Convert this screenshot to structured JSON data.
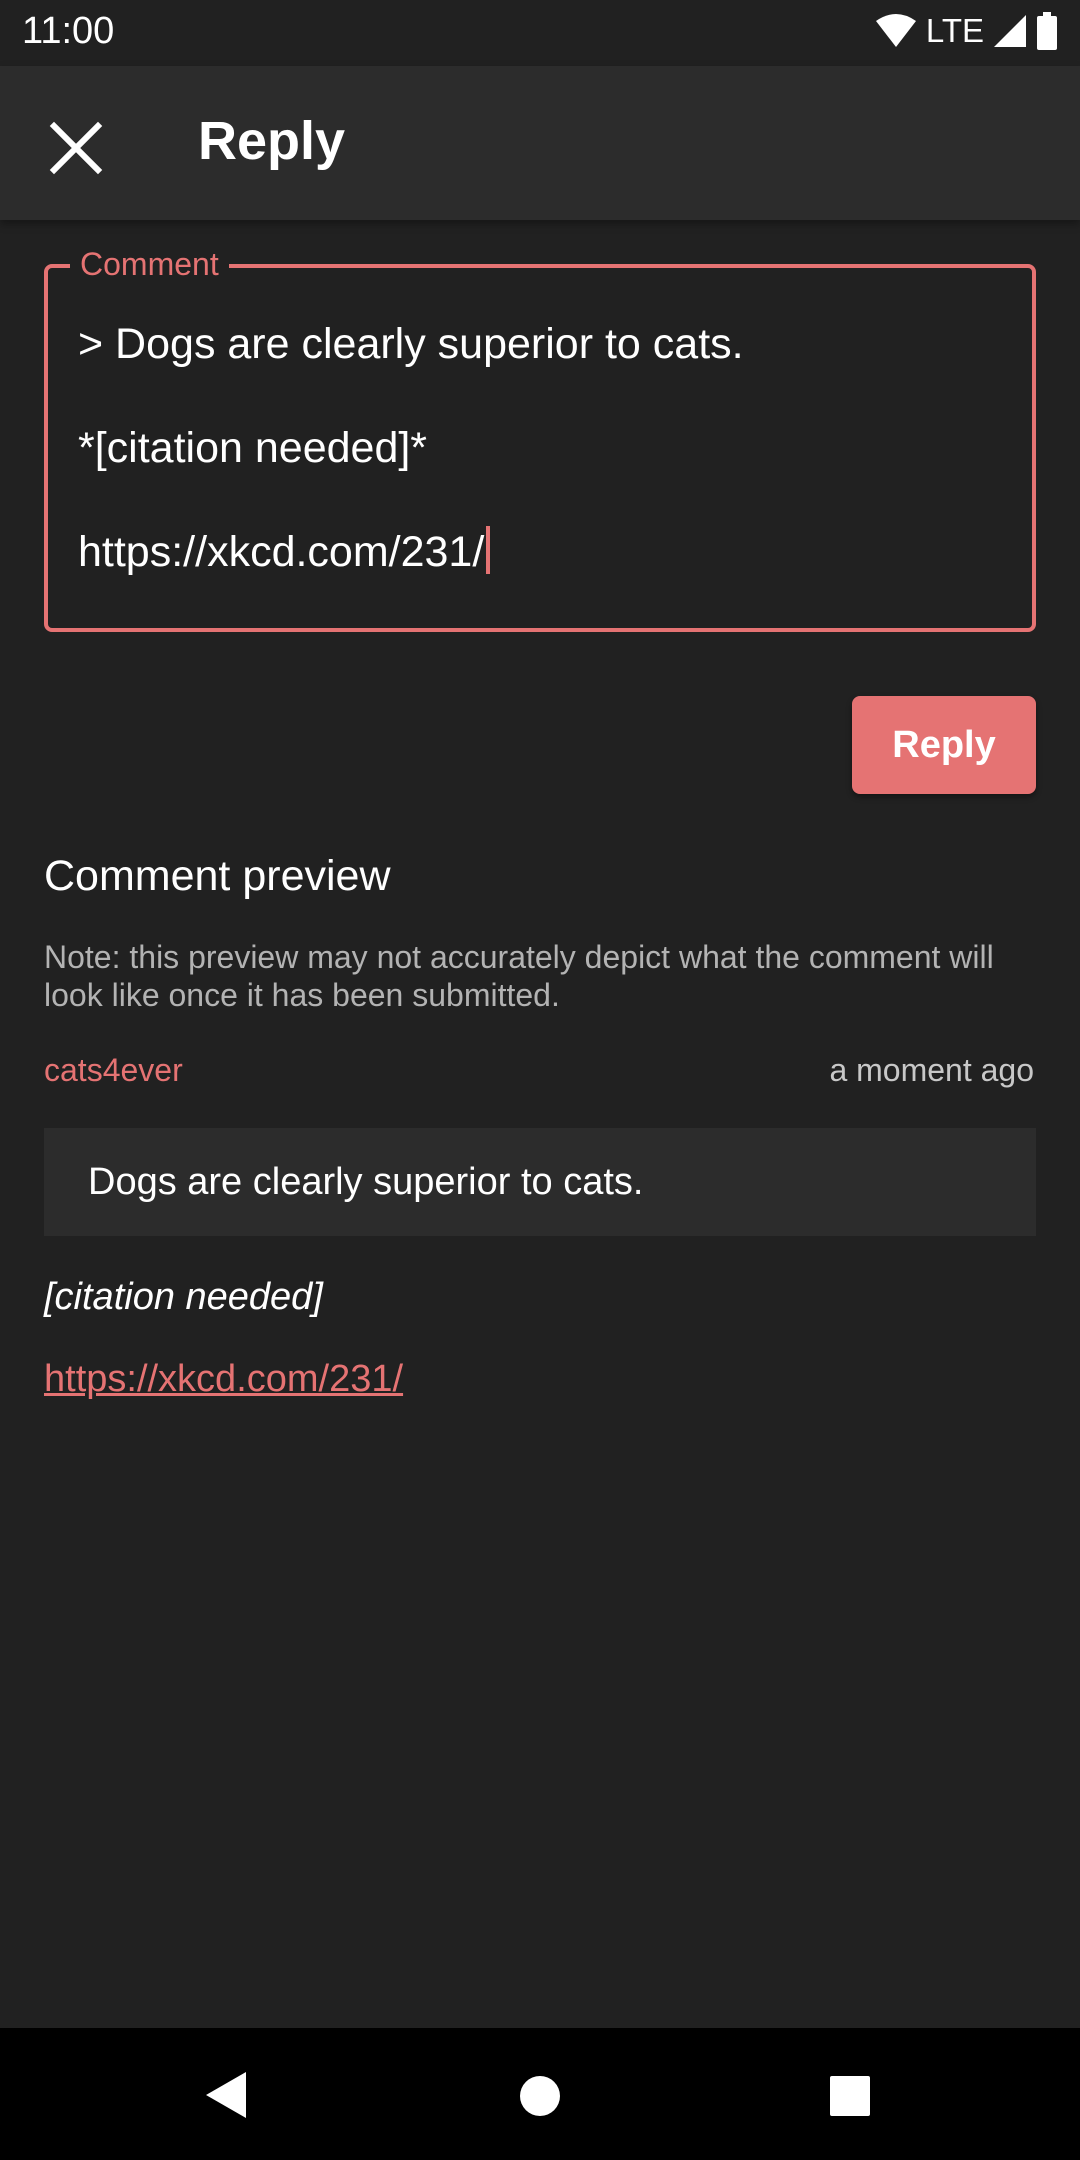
{
  "status_bar": {
    "time": "11:00",
    "network": "LTE",
    "icons": [
      "wifi-icon",
      "signal-icon",
      "battery-icon"
    ]
  },
  "app_bar": {
    "title": "Reply",
    "close_icon": "close-icon"
  },
  "comment_field": {
    "label": "Comment",
    "lines": [
      "> Dogs are clearly superior to cats.",
      "*[citation needed]*",
      "https://xkcd.com/231/"
    ]
  },
  "reply_button": {
    "label": "Reply"
  },
  "preview": {
    "heading": "Comment preview",
    "note": "Note: this preview may not accurately depict what the comment will look like once it has been submitted.",
    "author": "cats4ever",
    "time": "a moment ago",
    "quote": "Dogs are clearly superior to cats.",
    "italic_text": "[citation needed]",
    "link": "https://xkcd.com/231/"
  },
  "colors": {
    "accent": "#e57373",
    "background": "#212121",
    "surface": "#2c2c2c"
  },
  "nav_bar": {
    "icons": [
      "back-icon",
      "home-icon",
      "recents-icon"
    ]
  }
}
